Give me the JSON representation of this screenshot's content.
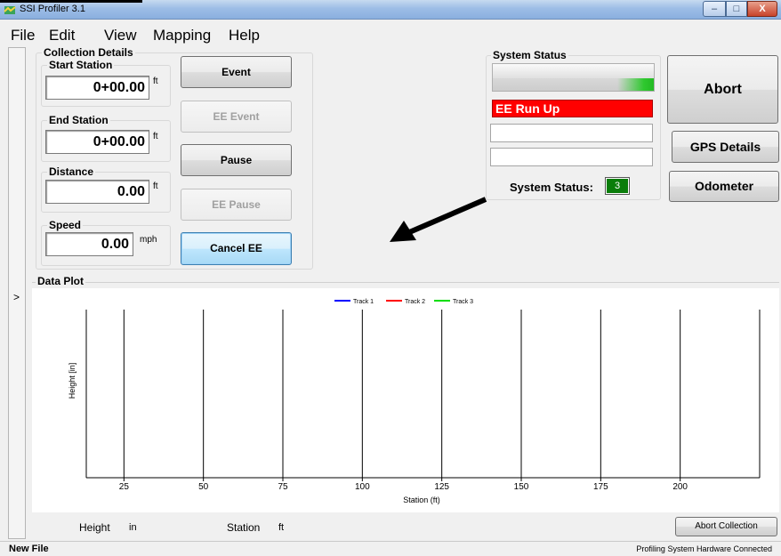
{
  "window": {
    "title": "SSI Profiler 3.1",
    "controls": {
      "minimize": "–",
      "maximize": "□",
      "close": "X"
    }
  },
  "menu": [
    "File",
    "Edit",
    "View",
    "Mapping",
    "Help"
  ],
  "side_panel": {
    "expand_glyph": ">"
  },
  "collection_details": {
    "title": "Collection Details",
    "start_station": {
      "label": "Start Station",
      "value": "0+00.00",
      "unit": "ft"
    },
    "end_station": {
      "label": "End Station",
      "value": "0+00.00",
      "unit": "ft"
    },
    "distance": {
      "label": "Distance",
      "value": "0.00",
      "unit": "ft"
    },
    "speed": {
      "label": "Speed",
      "value": "0.00",
      "unit": "mph"
    },
    "buttons": {
      "event": "Event",
      "ee_event": "EE Event",
      "pause": "Pause",
      "ee_pause": "EE Pause",
      "cancel_ee": "Cancel EE"
    }
  },
  "system_status": {
    "title": "System Status",
    "message": "EE Run Up",
    "message_color": "#ff0000",
    "status_label": "System Status:",
    "status_value": "3",
    "status_color": "#0a7d0a"
  },
  "right_buttons": {
    "abort": "Abort",
    "gps_details": "GPS Details",
    "odometer": "Odometer"
  },
  "data_plot": {
    "title": "Data Plot"
  },
  "chart_data": {
    "type": "line",
    "xlabel": "Station (ft)",
    "ylabel": "Height [in]",
    "x_ticks": [
      25,
      50,
      75,
      100,
      125,
      150,
      175,
      200
    ],
    "xlim": [
      0,
      225
    ],
    "grid_x": true,
    "legend_position": "top-center",
    "series": [
      {
        "name": "Track 1",
        "color": "#0000ff",
        "values": []
      },
      {
        "name": "Track 2",
        "color": "#ff0000",
        "values": []
      },
      {
        "name": "Track 3",
        "color": "#00dd00",
        "values": []
      }
    ]
  },
  "bottom_bar": {
    "height_label": "Height",
    "height_unit": "in",
    "station_label": "Station",
    "station_unit": "ft",
    "abort_collection": "Abort Collection"
  },
  "statusbar": {
    "file": "New File",
    "hardware": "Profiling System Hardware Connected"
  }
}
